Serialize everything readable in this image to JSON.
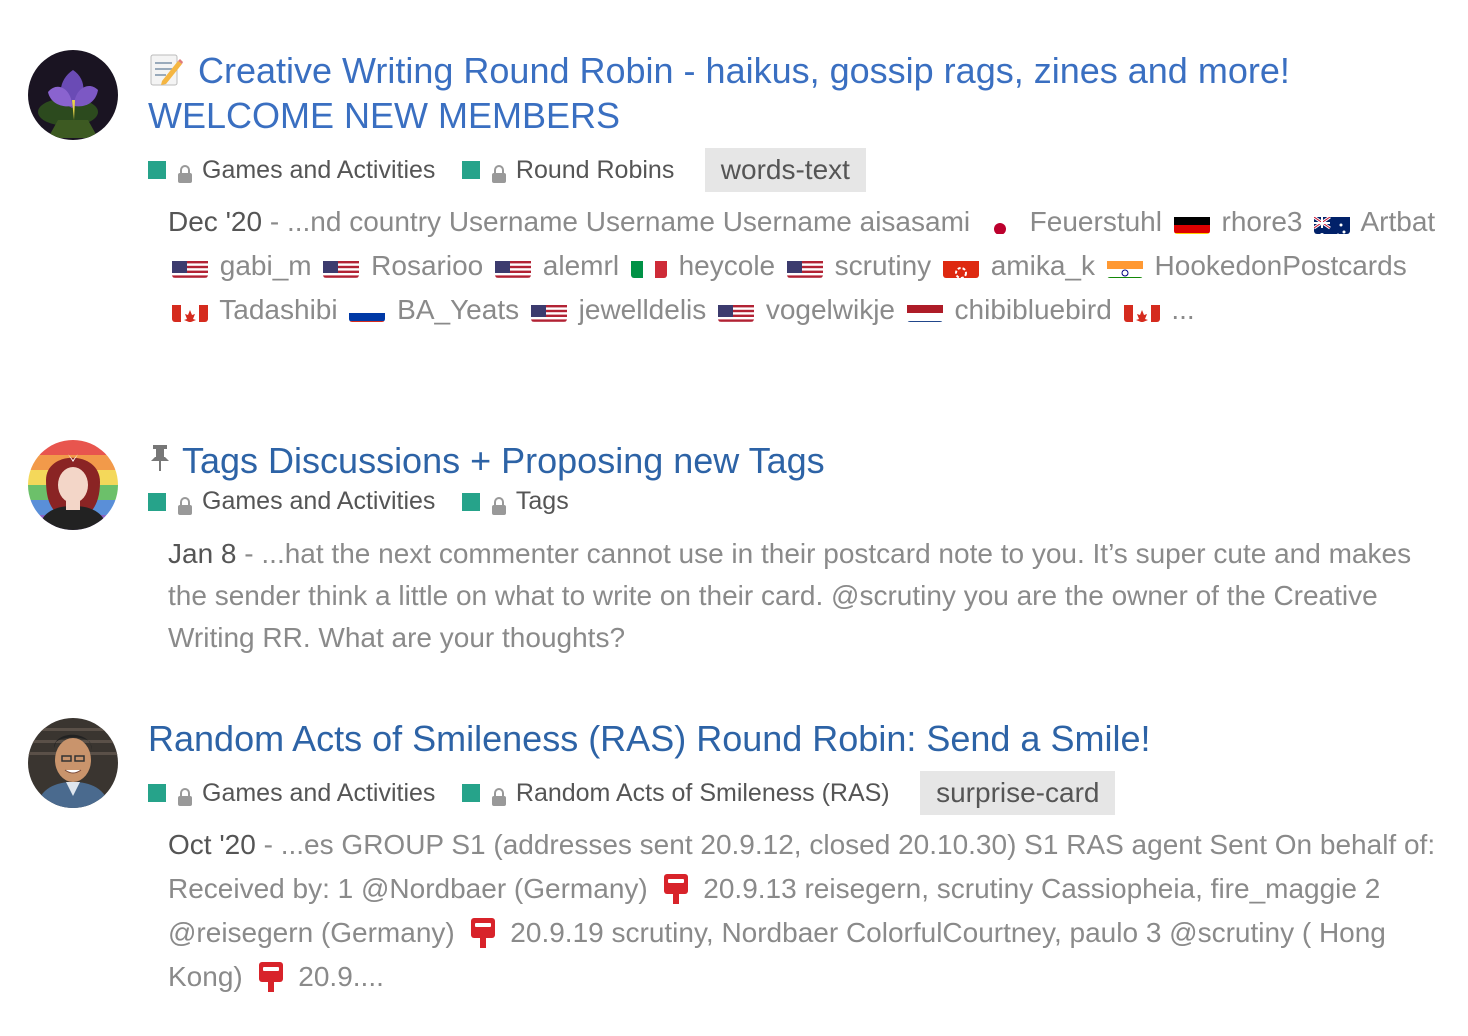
{
  "results": [
    {
      "title": "Creative Writing Round Robin - haikus, gossip rags, zines and more! WELCOME NEW MEMBERS",
      "title_emoji": "memo-icon",
      "categories": [
        "Games and Activities",
        "Round Robins"
      ],
      "tag": "words-text",
      "date": "Dec '20",
      "segments": [
        {
          "text": "...nd country Username Username Username aisasami"
        },
        {
          "flag": "Japan"
        },
        {
          "text": "Feuerstuhl"
        },
        {
          "flag": "Germany"
        },
        {
          "text": "rhore3"
        },
        {
          "flag": "Australia"
        },
        {
          "text": "Artbat"
        },
        {
          "flag": "USA"
        },
        {
          "text": "gabi_m"
        },
        {
          "flag": "USA"
        },
        {
          "text": "Rosarioo"
        },
        {
          "flag": "USA"
        },
        {
          "text": "alemrl"
        },
        {
          "flag": "Italy"
        },
        {
          "text": "heycole"
        },
        {
          "flag": "USA"
        },
        {
          "text": "scrutiny"
        },
        {
          "flag": "Hong Kong"
        },
        {
          "text": "amika_k"
        },
        {
          "flag": "India"
        },
        {
          "text": "HookedonPostcards"
        },
        {
          "flag": "Canada"
        },
        {
          "text": "Tadashibi"
        },
        {
          "flag": "Russia"
        },
        {
          "text": "BA_Yeats"
        },
        {
          "flag": "USA"
        },
        {
          "text": "jewelldelis"
        },
        {
          "flag": "USA"
        },
        {
          "text": "vogelwikje"
        },
        {
          "flag": "Netherlands"
        },
        {
          "text": "chibibluebird"
        },
        {
          "flag": "Canada"
        },
        {
          "text": "..."
        }
      ]
    },
    {
      "title": "Tags Discussions + Proposing new Tags",
      "title_icon": "pin-icon",
      "categories": [
        "Games and Activities",
        "Tags"
      ],
      "date": "Jan 8",
      "excerpt": "...hat the next commenter cannot use in their postcard note to you. It’s super cute and makes the sender think a little on what to write on their card. @scrutiny you are the owner of the Creative Writing RR. What are your thoughts?"
    },
    {
      "title": "Random Acts of Smileness (RAS) Round Robin: Send a Smile!",
      "categories": [
        "Games and Activities",
        "Random Acts of Smileness (RAS)"
      ],
      "tag": "surprise-card",
      "date": "Oct '20",
      "segments": [
        {
          "text": "...es GROUP S1 (addresses sent 20.9.12, closed 20.10.30) S1 RAS agent Sent On behalf of: Received by: 1 @Nordbaer (Germany)"
        },
        {
          "icon": "postbox-icon"
        },
        {
          "text": "20.9.13 reisegern, scrutiny Cassiopheia, fire_maggie 2 @reisegern (Germany)"
        },
        {
          "icon": "postbox-icon"
        },
        {
          "text": "20.9.19 scrutiny, Nordbaer ColorfulCourtney, paulo 3 @scrutiny ( Hong Kong)"
        },
        {
          "icon": "postbox-icon"
        },
        {
          "text": "20.9...."
        }
      ]
    }
  ],
  "colors": {
    "link": "#3a6fc1",
    "category_square": "#26a38a",
    "tag_bg": "#e6e6e6",
    "excerpt": "#8a8a8a"
  }
}
